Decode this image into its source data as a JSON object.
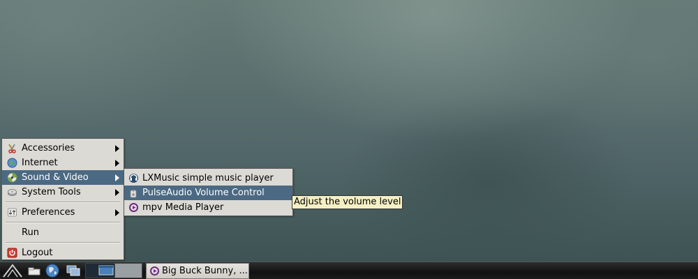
{
  "main_menu": {
    "items": [
      {
        "label": "Accessories",
        "icon": "accessories-icon",
        "has_submenu": true
      },
      {
        "label": "Internet",
        "icon": "internet-icon",
        "has_submenu": true
      },
      {
        "label": "Sound & Video",
        "icon": "sound-video-icon",
        "has_submenu": true,
        "active": true
      },
      {
        "label": "System Tools",
        "icon": "system-tools-icon",
        "has_submenu": true
      },
      {
        "label": "Preferences",
        "icon": "preferences-icon",
        "has_submenu": true
      },
      {
        "label": "Run",
        "icon": "",
        "has_submenu": false
      },
      {
        "label": "Logout",
        "icon": "logout-icon",
        "has_submenu": false
      }
    ]
  },
  "sound_video_menu": {
    "items": [
      {
        "label": "LXMusic simple music player",
        "icon": "lxmusic-icon"
      },
      {
        "label": "PulseAudio Volume Control",
        "icon": "pulseaudio-icon",
        "active": true
      },
      {
        "label": "mpv Media Player",
        "icon": "mpv-icon"
      }
    ]
  },
  "tooltip": {
    "text": "Adjust the volume level"
  },
  "taskbar": {
    "launchers": [
      "lxde-menu-icon",
      "file-manager-icon",
      "web-browser-icon",
      "window-switch-icon"
    ],
    "pager_desktops": 2,
    "active_task": {
      "label": "Big Buck Bunny, ...",
      "icon": "mpv-icon"
    }
  },
  "colors": {
    "menu_bg": "#dcdad5",
    "highlight": "#4b6983",
    "tooltip_bg": "#f5f0c4",
    "mpv_purple": "#6b2f7a"
  }
}
